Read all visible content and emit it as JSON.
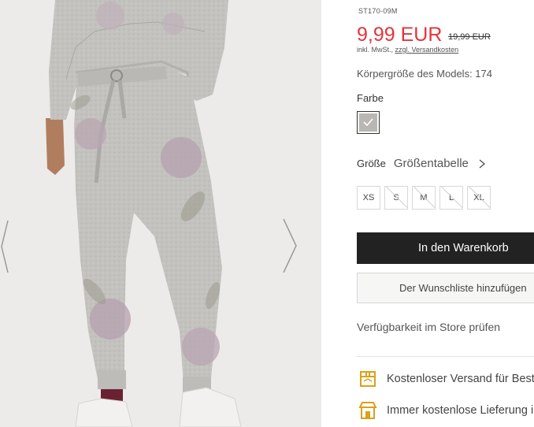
{
  "product": {
    "sku": "ST170-09M",
    "price": "9,99 EUR",
    "old_price": "19,99 EUR",
    "tax_note": "inkl. MwSt.,",
    "shipping_link": "zzgl. Versandkosten",
    "model_height": "Körpergröße des Models: 174"
  },
  "color": {
    "label": "Farbe",
    "swatch_color": "#b9b7b4",
    "swatch_icon": "check-icon"
  },
  "size": {
    "label": "Größe",
    "chart_link": "Größentabelle",
    "options": [
      {
        "label": "XS",
        "available": true
      },
      {
        "label": "S",
        "available": false
      },
      {
        "label": "M",
        "available": false
      },
      {
        "label": "L",
        "available": false
      },
      {
        "label": "XL",
        "available": false
      }
    ]
  },
  "actions": {
    "add_to_cart": "In den Warenkorb",
    "wishlist": "Der Wunschliste hinzufügen",
    "store_availability": "Verfügbarkeit im Store prüfen"
  },
  "benefits": [
    {
      "icon": "delivery-box-icon",
      "text": "Kostenloser Versand für Bestellungen"
    },
    {
      "icon": "store-icon",
      "text": "Immer kostenlose Lieferung in den Store"
    }
  ],
  "colors": {
    "price": "#e2353a",
    "cart_button": "#222222",
    "benefit_icon": "#d9a21b"
  }
}
